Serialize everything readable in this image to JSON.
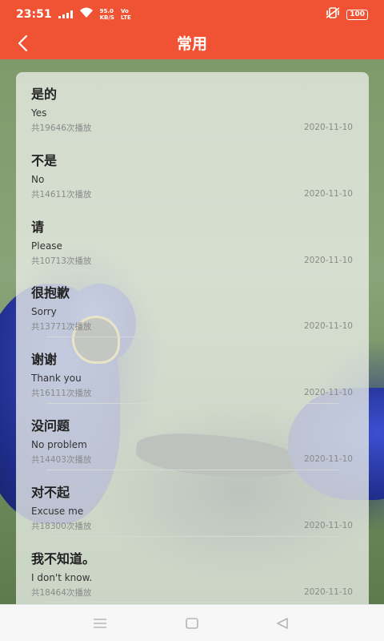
{
  "status_bar": {
    "time": "23:51",
    "net_speed": "95.0",
    "net_unit": "KB/S",
    "net_type_top": "Vo",
    "net_type_bottom": "LTE",
    "battery": "100"
  },
  "header": {
    "title": "常用",
    "color": "#ef5333"
  },
  "items": [
    {
      "word": "是的",
      "meaning": "Yes",
      "plays": "共19646次播放",
      "date": "2020-11-10"
    },
    {
      "word": "不是",
      "meaning": "No",
      "plays": "共14611次播放",
      "date": "2020-11-10"
    },
    {
      "word": "请",
      "meaning": "Please",
      "plays": "共10713次播放",
      "date": "2020-11-10"
    },
    {
      "word": "很抱歉",
      "meaning": "Sorry",
      "plays": "共13771次播放",
      "date": "2020-11-10"
    },
    {
      "word": "谢谢",
      "meaning": "Thank you",
      "plays": "共16111次播放",
      "date": "2020-11-10"
    },
    {
      "word": "没问题",
      "meaning": "No problem",
      "plays": "共14403次播放",
      "date": "2020-11-10"
    },
    {
      "word": "对不起",
      "meaning": "Excuse me",
      "plays": "共18300次播放",
      "date": "2020-11-10"
    },
    {
      "word": "我不知道。",
      "meaning": "I don't know.",
      "plays": "共18464次播放",
      "date": "2020-11-10"
    }
  ],
  "nav": {
    "icons": [
      "menu-icon",
      "home-square-icon",
      "back-triangle-icon"
    ]
  }
}
